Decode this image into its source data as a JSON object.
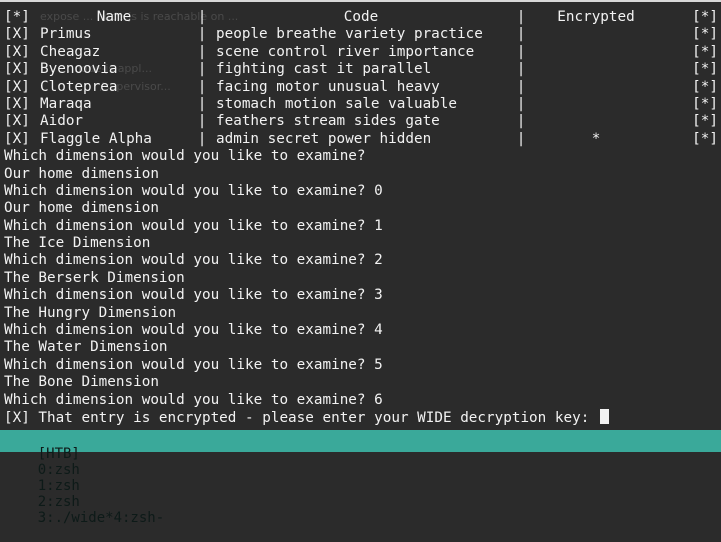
{
  "colors": {
    "background": "#2b2b2b",
    "text": "#f2f2f2",
    "statusbar_bg": "#3aa99a",
    "statusbar_text": "#0d1a18"
  },
  "table": {
    "header": {
      "status": "[*]",
      "name": "Name",
      "code": "Code",
      "encrypted": "Encrypted",
      "flag": "[*]"
    },
    "separator": "|",
    "rows": [
      {
        "status": "[X]",
        "name": "Primus",
        "code": "people breathe variety practice",
        "encrypted": "",
        "flag": "[*]"
      },
      {
        "status": "[X]",
        "name": "Cheagaz",
        "code": "scene control river importance",
        "encrypted": "",
        "flag": "[*]"
      },
      {
        "status": "[X]",
        "name": "Byenoovia",
        "code": "fighting cast it parallel",
        "encrypted": "",
        "flag": "[*]"
      },
      {
        "status": "[X]",
        "name": "Cloteprea",
        "code": "facing motor unusual heavy",
        "encrypted": "",
        "flag": "[*]"
      },
      {
        "status": "[X]",
        "name": "Maraqa",
        "code": "stomach motion sale valuable",
        "encrypted": "",
        "flag": "[*]"
      },
      {
        "status": "[X]",
        "name": "Aidor",
        "code": "feathers stream sides gate",
        "encrypted": "",
        "flag": "[*]"
      },
      {
        "status": "[X]",
        "name": "Flaggle Alpha",
        "code": "admin secret power hidden",
        "encrypted": "*",
        "flag": "[*]"
      }
    ]
  },
  "ghost_text": {
    "line1": "expose ... node-js is reachable on ...",
    "line2": "... node-js appl...",
    "line3": "/supervisor..."
  },
  "output_lines": [
    "Which dimension would you like to examine?",
    "Our home dimension",
    "Which dimension would you like to examine? 0",
    "Our home dimension",
    "Which dimension would you like to examine? 1",
    "The Ice Dimension",
    "Which dimension would you like to examine? 2",
    "The Berserk Dimension",
    "Which dimension would you like to examine? 3",
    "The Hungry Dimension",
    "Which dimension would you like to examine? 4",
    "The Water Dimension",
    "Which dimension would you like to examine? 5",
    "The Bone Dimension",
    "Which dimension would you like to examine? 6"
  ],
  "prompt": {
    "text": "[X] That entry is encrypted - please enter your WIDE decryption key: "
  },
  "statusbar": {
    "session": "[HTB]",
    "windows": [
      "0:zsh",
      "1:zsh",
      "2:zsh",
      "3:./wide*",
      "4:zsh-"
    ]
  }
}
